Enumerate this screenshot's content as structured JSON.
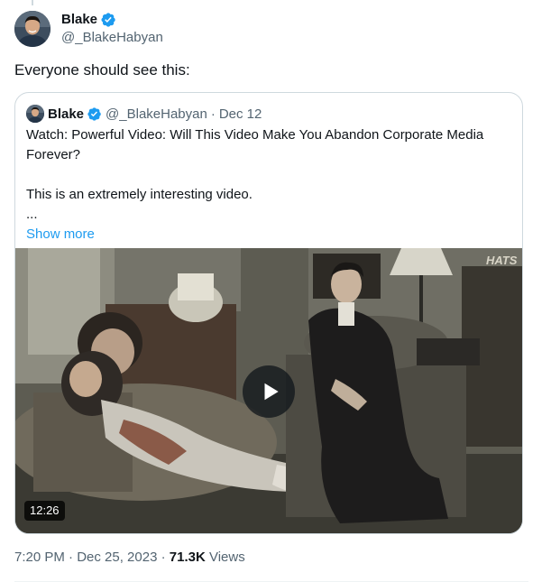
{
  "tweet": {
    "author": {
      "display_name": "Blake",
      "handle": "@_BlakeHabyan",
      "verified_icon": "verified-badge-icon",
      "avatar": "avatar-photo"
    },
    "text": "Everyone should see this:",
    "timestamp": "7:20 PM · Dec 25, 2023",
    "views_separator": " · ",
    "views_count": "71.3K",
    "views_label": " Views"
  },
  "quoted_tweet": {
    "author": {
      "display_name": "Blake",
      "handle": "@_BlakeHabyan",
      "verified_icon": "verified-badge-icon"
    },
    "separator": "·",
    "date": "Dec 12",
    "text_line1": "Watch: Powerful Video: Will This Video Make You Abandon Corporate Media Forever?",
    "text_line2": "This is an extremely interesting video.",
    "text_line3": "...",
    "show_more": "Show more",
    "video": {
      "duration": "12:26",
      "poster_text": "HATS",
      "play_icon": "play-icon"
    }
  },
  "colors": {
    "link": "#1d9bf0",
    "verified": "#1d9bf0",
    "secondary_text": "#536471",
    "border": "#cfd9de"
  }
}
